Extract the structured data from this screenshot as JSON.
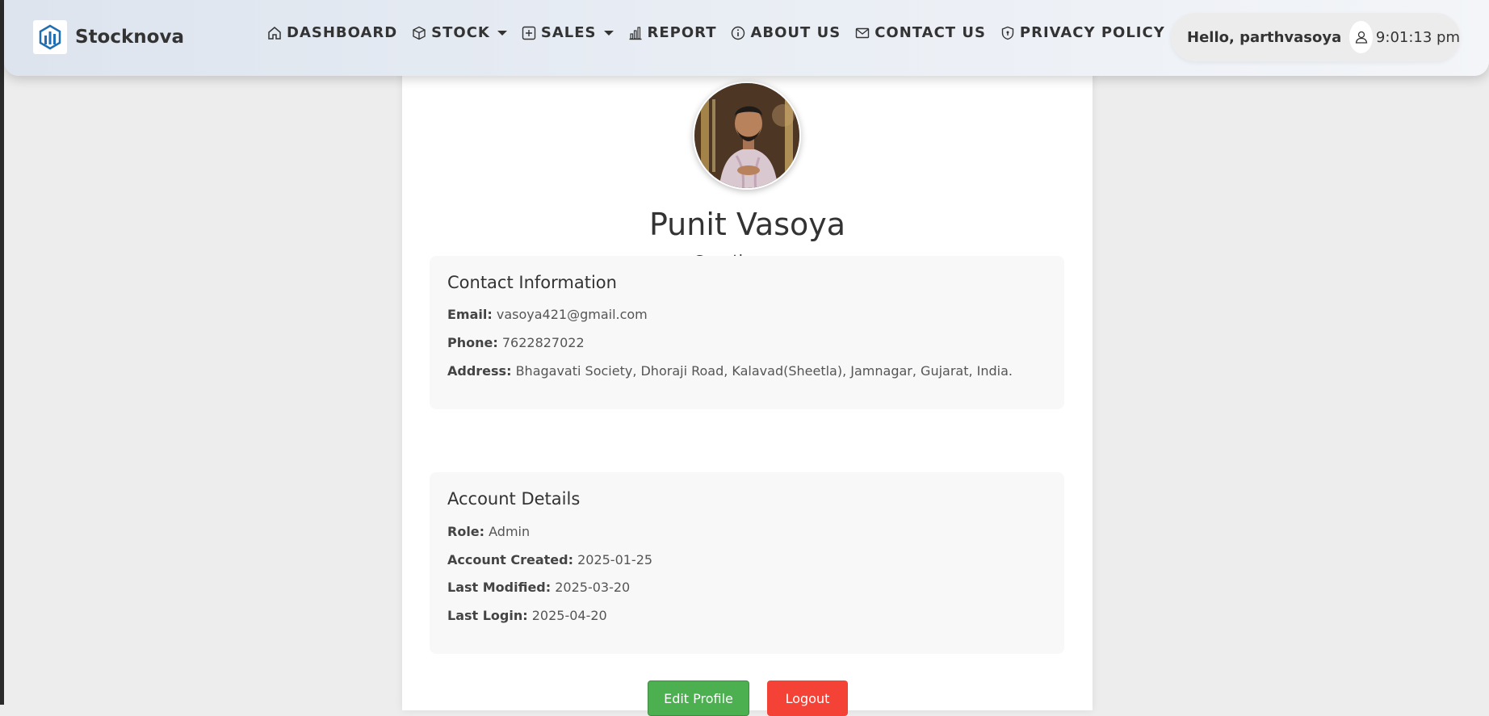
{
  "brand": {
    "name": "Stocknova"
  },
  "nav": {
    "dashboard": "DASHBOARD",
    "stock": "STOCK",
    "sales": "SALES",
    "report": "REPORT",
    "about": "ABOUT US",
    "contact": "CONTACT US",
    "privacy": "PRIVACY POLICY"
  },
  "user": {
    "greeting": "Hello, parthvasoya",
    "time": "9:01:13 pm"
  },
  "profile": {
    "name": "Punit Vasoya",
    "username": "@parthvasoya"
  },
  "contact": {
    "title": "Contact Information",
    "email_label": "Email:",
    "email": "vasoya421@gmail.com",
    "phone_label": "Phone:",
    "phone": "7622827022",
    "address_label": "Address:",
    "address": "Bhagavati Society, Dhoraji Road, Kalavad(Sheetla), Jamnagar, Gujarat, India."
  },
  "account": {
    "title": "Account Details",
    "role_label": "Role:",
    "role": "Admin",
    "created_label": "Account Created:",
    "created": "2025-01-25",
    "modified_label": "Last Modified:",
    "modified": "2025-03-20",
    "login_label": "Last Login:",
    "login": "2025-04-20"
  },
  "buttons": {
    "edit": "Edit Profile",
    "logout": "Logout"
  },
  "colors": {
    "accent_green": "#4caf50",
    "accent_red": "#f44336",
    "logo_blue": "#1f6fb2"
  },
  "icons": [
    "brand-logo-icon",
    "home-icon",
    "box-icon",
    "plus-square-icon",
    "bar-chart-icon",
    "info-icon",
    "envelope-icon",
    "shield-icon",
    "user-icon"
  ]
}
